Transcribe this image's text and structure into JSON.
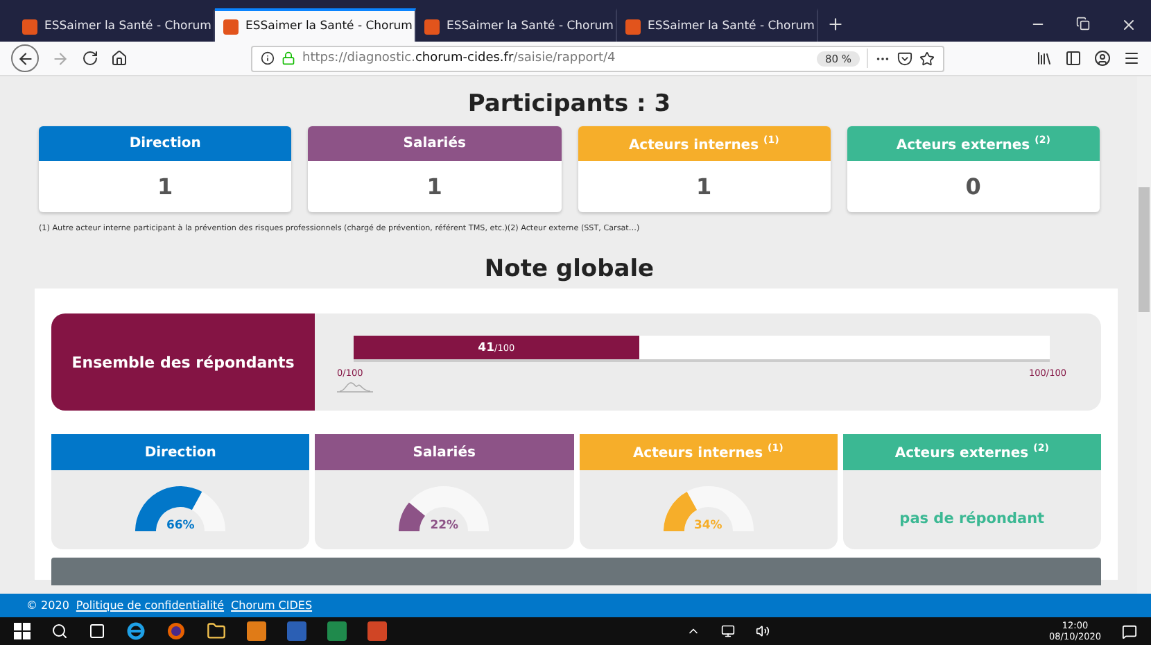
{
  "browser": {
    "tabs": [
      {
        "title": "ESSaimer la Santé - Chorum",
        "selected": false
      },
      {
        "title": "ESSaimer la Santé - Chorum",
        "selected": true
      },
      {
        "title": "ESSaimer la Santé - Chorum",
        "selected": false
      },
      {
        "title": "ESSaimer la Santé - Chorum",
        "selected": false
      }
    ],
    "url": {
      "prefix": "https://diagnostic.",
      "domain": "chorum-cides.fr",
      "path": "/saisie/rapport/4"
    },
    "zoom": "80 %"
  },
  "participants": {
    "title": "Participants : 3",
    "cards": [
      {
        "label": "Direction",
        "count": "1",
        "color": "#0277c9"
      },
      {
        "label": "Salariés",
        "count": "1",
        "color": "#8d5387"
      },
      {
        "label": "Acteurs internes $^{(1)}$",
        "count": "1",
        "color": "#f6ae2a"
      },
      {
        "label": "Acteurs externes $^{(2)}$",
        "count": "0",
        "color": "#3bb893"
      }
    ],
    "footnote": "(1) Autre acteur interne participant à la prévention des risques professionnels (chargé de prévention, référent TMS, etc.)(2) Acteur externe (SST, Carsat…)"
  },
  "note_globale": {
    "title": "Note globale",
    "overall": {
      "label": "Ensemble des répondants",
      "score": "41",
      "out_of": "/100",
      "level": 0.41,
      "min_label": "0/100",
      "max_label": "100/100"
    },
    "groups": [
      {
        "label": "Direction",
        "color": "#0277c9",
        "kind": "gauge",
        "reading": "66%"
      },
      {
        "label": "Salariés",
        "color": "#8d5387",
        "kind": "gauge",
        "reading": "22%"
      },
      {
        "label": "Acteurs internes $^{(1)}$",
        "color": "#f6ae2a",
        "kind": "gauge",
        "reading": "34%"
      },
      {
        "label": "Acteurs externes $^{(2)}$",
        "color": "#3bb893",
        "kind": "empty",
        "text": "pas de répondant"
      }
    ]
  },
  "footer": {
    "copyright": "© 2020",
    "links": [
      "Politique de confidentialité",
      "Chorum CIDES"
    ]
  },
  "taskbar": {
    "time": "12:00",
    "date": "08/10/2020"
  }
}
